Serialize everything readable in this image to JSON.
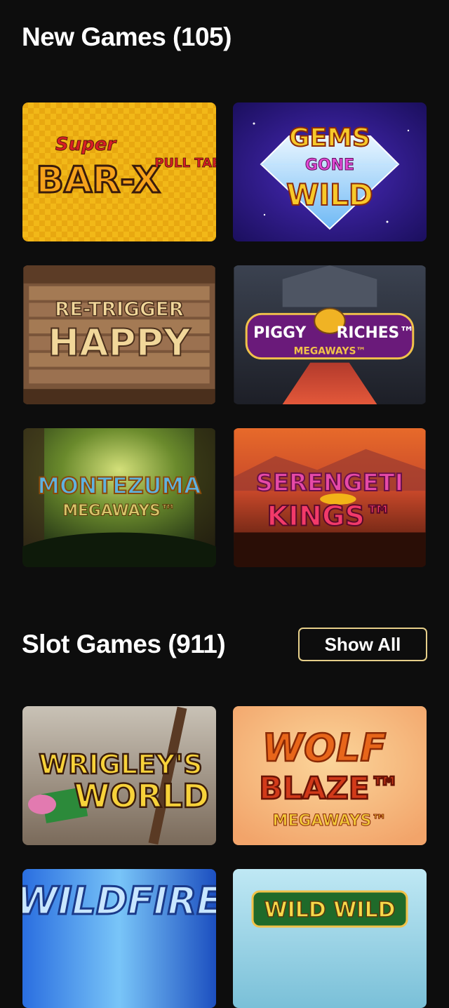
{
  "new_games": {
    "title": "New Games (105)",
    "games": [
      {
        "name_top": "Super",
        "name_main": "BAR-X",
        "name_sub": "PULL TAB"
      },
      {
        "name_top": "GEMS",
        "name_main": "GONE",
        "name_sub": "WILD"
      },
      {
        "name_top": "RE-TRIGGER",
        "name_main": "HAPPY"
      },
      {
        "name_top": "PIGGY",
        "name_main": "RICHES™",
        "name_sub": "MEGAWAYS™"
      },
      {
        "name_top": "MONTEZUMA",
        "name_sub": "MEGAWAYS™"
      },
      {
        "name_top": "SERENGETI",
        "name_main": "KINGS™"
      }
    ]
  },
  "slot_games": {
    "title": "Slot Games (911)",
    "show_all_label": "Show All",
    "games": [
      {
        "name_top": "WRIGLEY'S",
        "name_main": "WORLD"
      },
      {
        "name_top": "WOLF",
        "name_main": "BLAZE™",
        "name_sub": "MEGAWAYS™"
      },
      {
        "name_top": "WILDFIRE"
      },
      {
        "name_top": "WILD WILD"
      }
    ]
  }
}
